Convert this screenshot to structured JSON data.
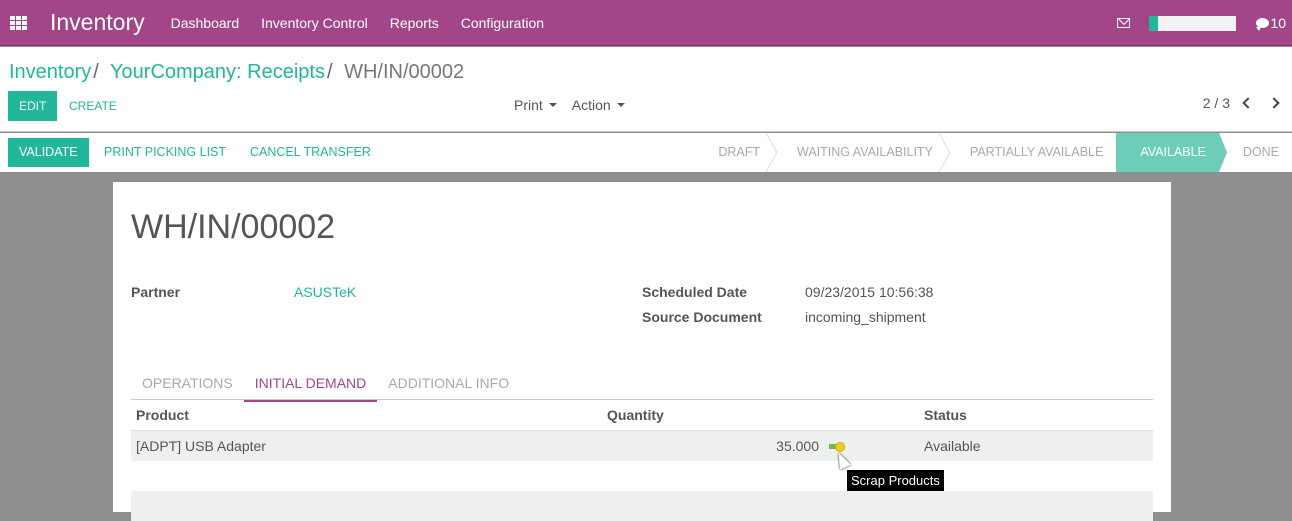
{
  "navbar": {
    "app_title": "Inventory",
    "menu": [
      "Dashboard",
      "Inventory Control",
      "Reports",
      "Configuration"
    ],
    "messages_icon": "envelope-icon",
    "progress": 0.1,
    "chat_count": "10",
    "colors": {
      "brand": "#a24689",
      "accent": "#21b799"
    }
  },
  "breadcrumb": {
    "items": [
      "Inventory",
      "YourCompany: Receipts"
    ],
    "current": "WH/IN/00002",
    "separator": "/"
  },
  "control": {
    "edit_label": "EDIT",
    "create_label": "CREATE",
    "print_label": "Print",
    "action_label": "Action",
    "pager": "2 / 3"
  },
  "statusbar": {
    "validate_label": "VALIDATE",
    "print_picking_label": "PRINT PICKING LIST",
    "cancel_label": "CANCEL TRANSFER",
    "stages": [
      "DRAFT",
      "WAITING AVAILABILITY",
      "PARTIALLY AVAILABLE",
      "AVAILABLE",
      "DONE"
    ],
    "active_stage": "AVAILABLE"
  },
  "record": {
    "title": "WH/IN/00002",
    "partner_label": "Partner",
    "partner_value": "ASUSTeK",
    "scheduled_date_label": "Scheduled Date",
    "scheduled_date_value": "09/23/2015 10:56:38",
    "source_document_label": "Source Document",
    "source_document_value": "incoming_shipment"
  },
  "tabs": {
    "items": [
      "OPERATIONS",
      "INITIAL DEMAND",
      "ADDITIONAL INFO"
    ],
    "active": "INITIAL DEMAND"
  },
  "table": {
    "columns": [
      "Product",
      "Quantity",
      "Status"
    ],
    "rows": [
      {
        "product": "[ADPT] USB Adapter",
        "quantity": "35.000",
        "status": "Available",
        "action_icon": "scrap-products-icon"
      }
    ]
  },
  "tooltip": "Scrap Products"
}
